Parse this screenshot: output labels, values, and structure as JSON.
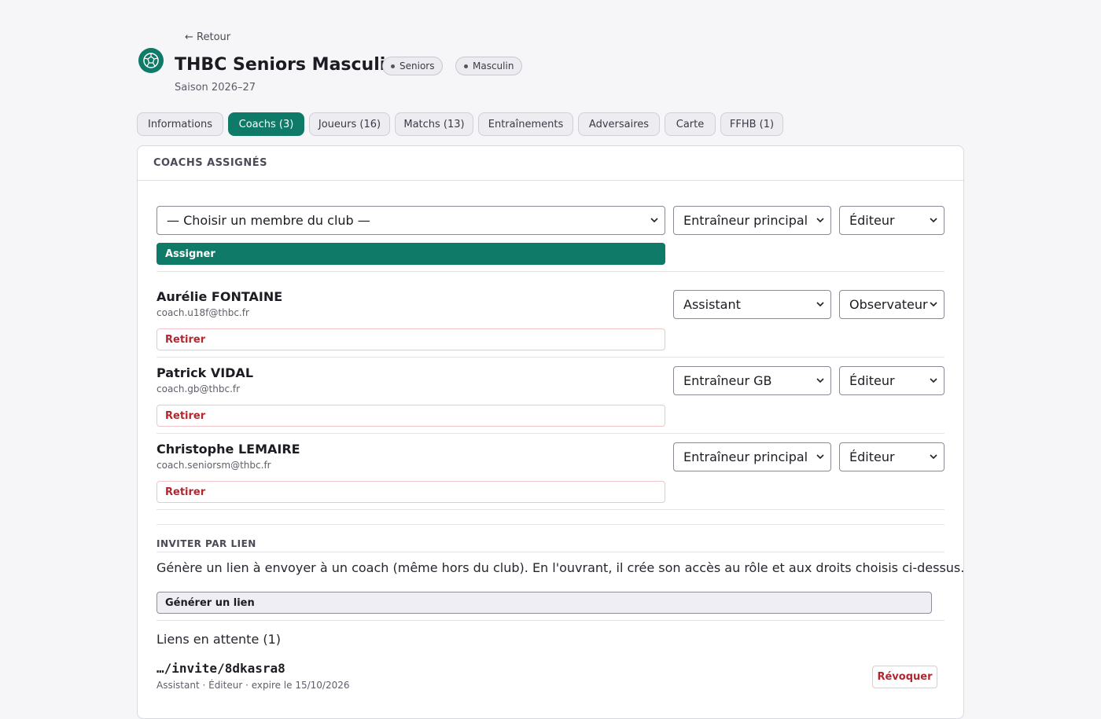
{
  "header": {
    "back_label": "← Retour",
    "team_name": "THBC Seniors Masculins",
    "badges": [
      "Seniors",
      "Masculin"
    ],
    "season": "Saison 2026–27"
  },
  "tabs": [
    {
      "label": "Informations",
      "active": false
    },
    {
      "label": "Coachs (3)",
      "active": true
    },
    {
      "label": "Joueurs (16)",
      "active": false
    },
    {
      "label": "Matchs (13)",
      "active": false
    },
    {
      "label": "Entraînements",
      "active": false
    },
    {
      "label": "Adversaires",
      "active": false
    },
    {
      "label": "Carte",
      "active": false
    },
    {
      "label": "FFHB (1)",
      "active": false
    }
  ],
  "coaches_card": {
    "title": "COACHS ASSIGNÉS",
    "assign_form": {
      "member_select": "— Choisir un membre du club —",
      "role_select": "Entraîneur principal",
      "rights_select": "Éditeur",
      "assign_button": "Assigner"
    },
    "coaches": [
      {
        "name": "Aurélie FONTAINE",
        "email": "coach.u18f@thbc.fr",
        "role": "Assistant",
        "rights": "Observateur",
        "remove_label": "Retirer"
      },
      {
        "name": "Patrick VIDAL",
        "email": "coach.gb@thbc.fr",
        "role": "Entraîneur GB",
        "rights": "Éditeur",
        "remove_label": "Retirer"
      },
      {
        "name": "Christophe LEMAIRE",
        "email": "coach.seniorsm@thbc.fr",
        "role": "Entraîneur principal",
        "rights": "Éditeur",
        "remove_label": "Retirer"
      }
    ],
    "invite": {
      "section_title": "INVITER PAR LIEN",
      "description": "Génère un lien à envoyer à un coach (même hors du club). En l'ouvrant, il crée son accès au rôle et aux droits choisis ci-dessus.",
      "generate_button": "Générer un lien",
      "pending_title": "Liens en attente (1)",
      "pending_links": [
        {
          "link": "…/invite/8dkasra8",
          "meta": "Assistant · Éditeur · expire le 15/10/2026",
          "revoke_label": "Révoquer"
        }
      ]
    }
  },
  "colors": {
    "accent": "#0f7a68",
    "danger": "#b3262e",
    "background": "#f6f6f8"
  }
}
